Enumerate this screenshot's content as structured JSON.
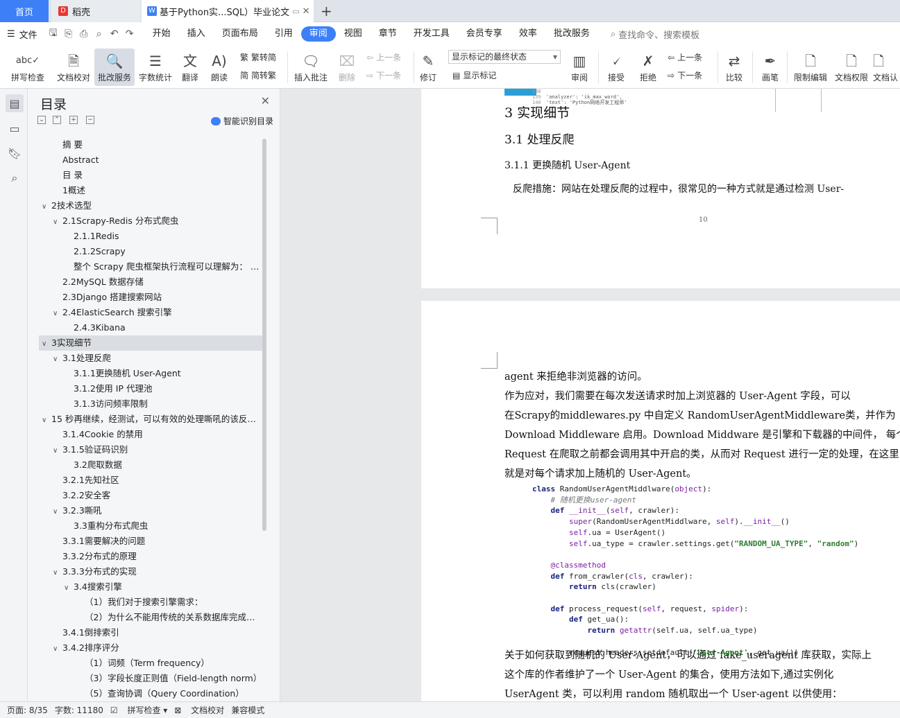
{
  "tabs": {
    "home": "首页",
    "wps": "稻壳",
    "doc": "基于Python实...SQL）毕业论文"
  },
  "menu": {
    "file": "文件",
    "tabs": [
      "开始",
      "插入",
      "页面布局",
      "引用",
      "审阅",
      "视图",
      "章节",
      "开发工具",
      "会员专享",
      "效率",
      "批改服务"
    ],
    "active_tab": "审阅",
    "search": "查找命令、搜索模板"
  },
  "ribbon": {
    "spell_check": "拼写检查",
    "doc_check": "文档校对",
    "review_service": "批改服务",
    "word_count": "字数统计",
    "translate": "翻译",
    "read_aloud": "朗读",
    "trad": "繁转简",
    "simp": "简转繁",
    "insert_comment": "插入批注",
    "delete": "删除",
    "prev": "上一条",
    "next": "下一条",
    "track": "修订",
    "markup_state": "显示标记的最终状态",
    "show_markup": "显示标记",
    "review": "审阅",
    "accept": "接受",
    "reject": "拒绝",
    "prev2": "上一条",
    "next2": "下一条",
    "compare": "比较",
    "pen": "画笔",
    "restrict_edit": "限制编辑",
    "doc_perm": "文档权限",
    "doc_cert": "文档认"
  },
  "nav": {
    "title": "目录",
    "smart_toc": "智能识别目录",
    "items": [
      {
        "label": "摘  要",
        "level": 1,
        "chev": ""
      },
      {
        "label": "Abstract",
        "level": 1,
        "chev": ""
      },
      {
        "label": "目  录",
        "level": 1,
        "chev": ""
      },
      {
        "label": "1概述",
        "level": 1,
        "chev": ""
      },
      {
        "label": "2技术选型",
        "level": 0,
        "chev": "v"
      },
      {
        "label": "2.1Scrapy-Redis 分布式爬虫",
        "level": 1,
        "chev": "v"
      },
      {
        "label": "2.1.1Redis",
        "level": 2,
        "chev": ""
      },
      {
        "label": "2.1.2Scrapy",
        "level": 2,
        "chev": ""
      },
      {
        "label": "整个 Scrapy 爬虫框架执行流程可以理解为：  爬...",
        "level": 2,
        "chev": ""
      },
      {
        "label": "2.2MySQL 数据存储",
        "level": 1,
        "chev": ""
      },
      {
        "label": "2.3Django 搭建搜索网站",
        "level": 1,
        "chev": ""
      },
      {
        "label": "2.4ElasticSearch 搜索引擎",
        "level": 1,
        "chev": "v"
      },
      {
        "label": "2.4.3Kibana",
        "level": 2,
        "chev": ""
      },
      {
        "label": "3实现细节",
        "level": 0,
        "chev": "v",
        "sel": true
      },
      {
        "label": "3.1处理反爬",
        "level": 1,
        "chev": "v"
      },
      {
        "label": "3.1.1更换随机 User-Agent",
        "level": 2,
        "chev": ""
      },
      {
        "label": "3.1.2使用 IP 代理池",
        "level": 2,
        "chev": ""
      },
      {
        "label": "3.1.3访问频率限制",
        "level": 2,
        "chev": ""
      },
      {
        "label": "15 秒再继续，经测试，可以有效的处理嘶吼的该反爬...",
        "level": 0,
        "chev": "v"
      },
      {
        "label": "3.1.4Cookie 的禁用",
        "level": 1,
        "chev": ""
      },
      {
        "label": "3.1.5验证码识别",
        "level": 1,
        "chev": "v"
      },
      {
        "label": "3.2爬取数据",
        "level": 2,
        "chev": ""
      },
      {
        "label": "3.2.1先知社区",
        "level": 1,
        "chev": ""
      },
      {
        "label": "3.2.2安全客",
        "level": 1,
        "chev": ""
      },
      {
        "label": "3.2.3嘶吼",
        "level": 1,
        "chev": "v"
      },
      {
        "label": "3.3重构分布式爬虫",
        "level": 2,
        "chev": ""
      },
      {
        "label": "3.3.1需要解决的问题",
        "level": 1,
        "chev": ""
      },
      {
        "label": "3.3.2分布式的原理",
        "level": 1,
        "chev": ""
      },
      {
        "label": "3.3.3分布式的实现",
        "level": 1,
        "chev": "v"
      },
      {
        "label": "3.4搜索引擎",
        "level": 2,
        "chev": "v"
      },
      {
        "label": "（1）我们对于搜索引擎需求：",
        "level": 3,
        "chev": ""
      },
      {
        "label": "（2）为什么不能用传统的关系数据库完成搜...",
        "level": 3,
        "chev": ""
      },
      {
        "label": "3.4.1倒排索引",
        "level": 1,
        "chev": ""
      },
      {
        "label": "3.4.2排序评分",
        "level": 1,
        "chev": "v"
      },
      {
        "label": "（1）词频（Term frequency）",
        "level": 3,
        "chev": ""
      },
      {
        "label": "（3）字段长度正则值（Field-length norm）",
        "level": 3,
        "chev": ""
      },
      {
        "label": "（5）查询协调（Query Coordination）",
        "level": 3,
        "chev": ""
      }
    ]
  },
  "doc": {
    "code_top": [
      "'analyzer': 'ik_max_word',",
      "'text': 'Python网络开发工程师'"
    ],
    "code_top_nums": [
      "138",
      "139",
      "140"
    ],
    "h1": "3  实现细节",
    "h2": "3.1  处理反爬",
    "h3": "3.1.1  更换随机 User-Agent",
    "p1": "反爬措施：网站在处理反爬的过程中，很常见的一种方式就是通过检测 User-",
    "page_number": "10",
    "lines": [
      "agent 来拒绝非浏览器的访问。",
      "      作为应对，我们需要在每次发送请求时加上浏览器的 User-Agent 字段，可以",
      "在Scrapy的middlewares.py 中自定义 RandomUserAgentMiddleware类，并作为",
      "Download Middleware 启用。Download  Middware 是引擎和下载器的中间件，  每个",
      "Request 在爬取之前都会调用其中开启的类，从而对 Request 进行一定的处理，在这里",
      "就是对每个请求加上随机的 User-Agent。"
    ],
    "tail": [
      "      关于如何获取到随机的 User-Agent，可以通过 fake_useragent 库获取，实际上",
      "这个库的作者维护了一个 User-Agent 的集合，使用方法如下,通过实例化",
      "UserAgent 类，可以利用 random 随机取出一个 User-agent 以供使用："
    ]
  },
  "status": {
    "page": "页面: 8/35",
    "words": "字数: 11180",
    "spell": "拼写检查",
    "check": "文档校对",
    "compat": "兼容模式"
  }
}
